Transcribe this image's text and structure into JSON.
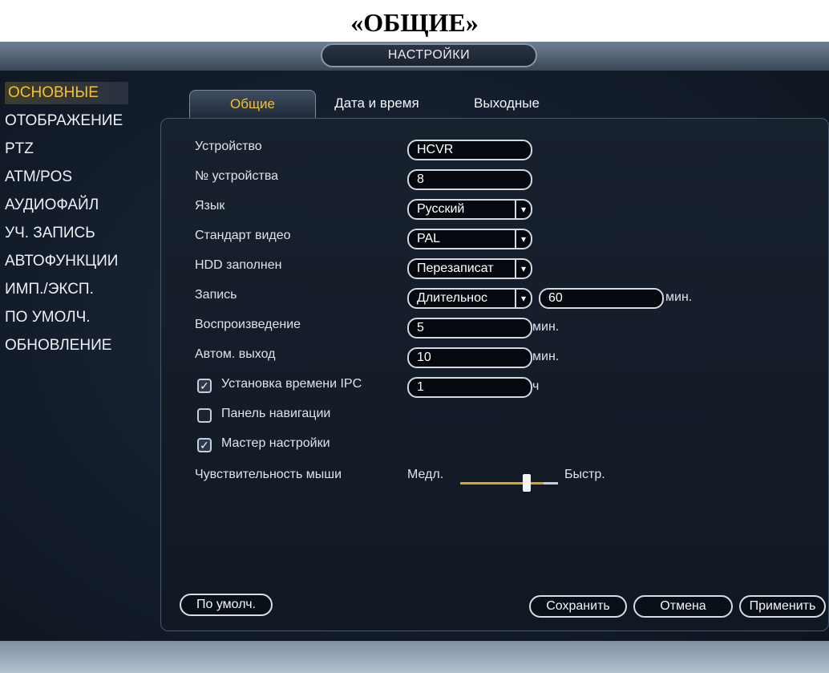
{
  "document_heading": "«ОБЩИЕ»",
  "window_title": "НАСТРОЙКИ",
  "left_menu": [
    {
      "label": "ОСНОВНЫЕ",
      "active": true
    },
    {
      "label": "ОТОБРАЖЕНИЕ",
      "active": false
    },
    {
      "label": "PTZ",
      "active": false
    },
    {
      "label": "ATM/POS",
      "active": false
    },
    {
      "label": "АУДИОФАЙЛ",
      "active": false
    },
    {
      "label": "УЧ. ЗАПИСЬ",
      "active": false
    },
    {
      "label": "АВТОФУНКЦИИ",
      "active": false
    },
    {
      "label": "ИМП./ЭКСП.",
      "active": false
    },
    {
      "label": "ПО УМОЛЧ.",
      "active": false
    },
    {
      "label": "ОБНОВЛЕНИЕ",
      "active": false
    }
  ],
  "tabs": [
    {
      "label": "Общие",
      "active": true
    },
    {
      "label": "Дата и время",
      "active": false
    },
    {
      "label": "Выходные",
      "active": false
    }
  ],
  "form": {
    "device_name": {
      "label": "Устройство",
      "value": "HCVR"
    },
    "device_number": {
      "label": "№ устройства",
      "value": "8"
    },
    "language": {
      "label": "Язык",
      "value": "Русский"
    },
    "video_standard": {
      "label": "Стандарт видео",
      "value": "PAL"
    },
    "hdd_full": {
      "label": "HDD заполнен",
      "value": "Перезаписат"
    },
    "record": {
      "label": "Запись",
      "value": "Длительнос",
      "duration": "60",
      "unit": "мин."
    },
    "playback": {
      "label": "Воспроизведение",
      "value": "5",
      "unit": "мин."
    },
    "auto_logout": {
      "label": "Автом. выход",
      "value": "10",
      "unit": "мин."
    },
    "ipc_time_sync": {
      "label": "Установка времени IPC",
      "checked": true,
      "value": "1",
      "unit": "ч"
    },
    "nav_bar": {
      "label": "Панель навигации",
      "checked": false
    },
    "startup_wizard": {
      "label": "Мастер настройки",
      "checked": true
    },
    "mouse_sensitivity": {
      "label": "Чувствительность мыши",
      "slow": "Медл.",
      "fast": "Быстр.",
      "level": 0.75
    }
  },
  "buttons": {
    "default": "По умолч.",
    "save": "Сохранить",
    "cancel": "Отмена",
    "apply": "Применить"
  },
  "icons": {
    "dropdown": "chevron-down-icon",
    "check": "checkmark-icon"
  },
  "colors": {
    "accent": "#f3c12a",
    "background": "#131c2a",
    "text": "#eef1f5"
  }
}
